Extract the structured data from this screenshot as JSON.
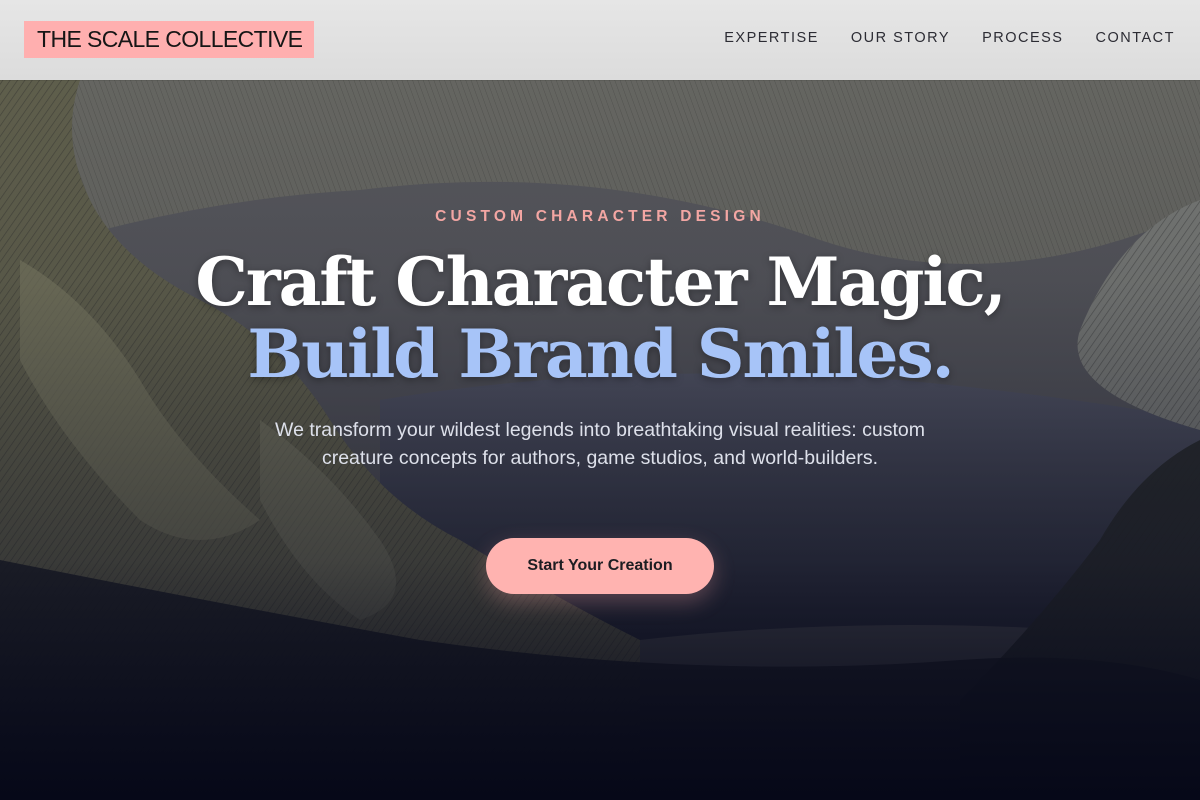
{
  "header": {
    "brand": "THE SCALE COLLECTIVE",
    "nav": [
      {
        "label": "EXPERTISE"
      },
      {
        "label": "OUR STORY"
      },
      {
        "label": "PROCESS"
      },
      {
        "label": "CONTACT"
      }
    ]
  },
  "hero": {
    "eyebrow": "CUSTOM CHARACTER DESIGN",
    "headline_line1": "Craft Character Magic,",
    "headline_line2": "Build Brand Smiles.",
    "subtitle": "We transform your wildest legends into breathtaking visual realities: custom creature concepts for authors, game studios, and world-builders.",
    "cta_label": "Start Your Creation"
  },
  "colors": {
    "brand_highlight": "#ffafaf",
    "eyebrow": "#f3a6a3",
    "headline_accent": "#a7c4f8",
    "cta_background": "#ffb3b0",
    "header_background": "#e2e2e2",
    "hero_bottom": "#060818"
  }
}
